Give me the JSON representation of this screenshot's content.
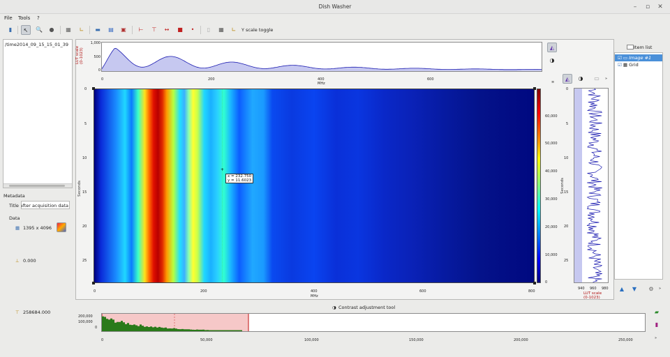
{
  "window": {
    "title": "Dish Washer"
  },
  "menu": [
    "File",
    "Tools",
    "?"
  ],
  "toolbar": {
    "y_scale_toggle": "Y scale toggle"
  },
  "file_list": {
    "items": [
      "/time2014_09_15_15_01_39"
    ]
  },
  "metadata": {
    "heading": "Metadata",
    "title_label": "Title",
    "title_value": "after acquisition data",
    "data_heading": "Data",
    "size_value": "1395 x 4096",
    "min_value": "0.000",
    "max_value": "258684.000"
  },
  "xprofile": {
    "ylabel": "LUT scale",
    "ylabel2": "(0-1023)",
    "yticks": [
      "1,000",
      "500",
      "0"
    ],
    "xticks": [
      "0",
      "200",
      "400",
      "600"
    ],
    "xunit": "MHz"
  },
  "image_plot": {
    "xlabel": "MHz",
    "ylabel": "Seconds",
    "xticks": [
      "0",
      "200",
      "400",
      "600",
      "800"
    ],
    "yticks": [
      "0",
      "5",
      "10",
      "15",
      "20",
      "25"
    ],
    "colorbar_ticks": [
      "60,000",
      "50,000",
      "40,000",
      "30,000",
      "20,000",
      "10,000",
      "0"
    ],
    "cursor": {
      "x_line": "x = 232.750",
      "y_line": "y = 11.6023"
    }
  },
  "yprofile": {
    "xticks": [
      "940",
      "960",
      "980"
    ],
    "xlabel": "LUT scale",
    "xlabel2": "(0-1023)",
    "yticks": [
      "0",
      "5",
      "10",
      "15",
      "20",
      "25"
    ],
    "ylabel": "Seconds"
  },
  "item_list": {
    "heading": "Item list",
    "items": [
      {
        "label": "Image #1"
      },
      {
        "label": "Grid"
      }
    ]
  },
  "contrast": {
    "title": "Contrast adjustment tool",
    "yticks": [
      "200,000",
      "100,000",
      "0"
    ],
    "xticks": [
      "0",
      "50,000",
      "100,000",
      "150,000",
      "200,000",
      "250,000"
    ]
  },
  "colors": {
    "accent": "#4a90d9",
    "profile_line": "#1a1ab0",
    "histogram": "#2a7a1a",
    "range_fill": "#f6c8c8"
  }
}
